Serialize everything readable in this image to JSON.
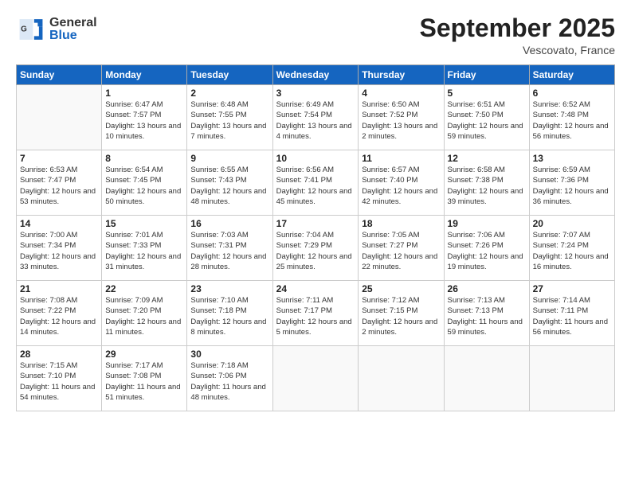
{
  "logo": {
    "general": "General",
    "blue": "Blue"
  },
  "header": {
    "month": "September 2025",
    "location": "Vescovato, France"
  },
  "weekdays": [
    "Sunday",
    "Monday",
    "Tuesday",
    "Wednesday",
    "Thursday",
    "Friday",
    "Saturday"
  ],
  "weeks": [
    [
      {
        "num": "",
        "sunrise": "",
        "sunset": "",
        "daylight": ""
      },
      {
        "num": "1",
        "sunrise": "Sunrise: 6:47 AM",
        "sunset": "Sunset: 7:57 PM",
        "daylight": "Daylight: 13 hours and 10 minutes."
      },
      {
        "num": "2",
        "sunrise": "Sunrise: 6:48 AM",
        "sunset": "Sunset: 7:55 PM",
        "daylight": "Daylight: 13 hours and 7 minutes."
      },
      {
        "num": "3",
        "sunrise": "Sunrise: 6:49 AM",
        "sunset": "Sunset: 7:54 PM",
        "daylight": "Daylight: 13 hours and 4 minutes."
      },
      {
        "num": "4",
        "sunrise": "Sunrise: 6:50 AM",
        "sunset": "Sunset: 7:52 PM",
        "daylight": "Daylight: 13 hours and 2 minutes."
      },
      {
        "num": "5",
        "sunrise": "Sunrise: 6:51 AM",
        "sunset": "Sunset: 7:50 PM",
        "daylight": "Daylight: 12 hours and 59 minutes."
      },
      {
        "num": "6",
        "sunrise": "Sunrise: 6:52 AM",
        "sunset": "Sunset: 7:48 PM",
        "daylight": "Daylight: 12 hours and 56 minutes."
      }
    ],
    [
      {
        "num": "7",
        "sunrise": "Sunrise: 6:53 AM",
        "sunset": "Sunset: 7:47 PM",
        "daylight": "Daylight: 12 hours and 53 minutes."
      },
      {
        "num": "8",
        "sunrise": "Sunrise: 6:54 AM",
        "sunset": "Sunset: 7:45 PM",
        "daylight": "Daylight: 12 hours and 50 minutes."
      },
      {
        "num": "9",
        "sunrise": "Sunrise: 6:55 AM",
        "sunset": "Sunset: 7:43 PM",
        "daylight": "Daylight: 12 hours and 48 minutes."
      },
      {
        "num": "10",
        "sunrise": "Sunrise: 6:56 AM",
        "sunset": "Sunset: 7:41 PM",
        "daylight": "Daylight: 12 hours and 45 minutes."
      },
      {
        "num": "11",
        "sunrise": "Sunrise: 6:57 AM",
        "sunset": "Sunset: 7:40 PM",
        "daylight": "Daylight: 12 hours and 42 minutes."
      },
      {
        "num": "12",
        "sunrise": "Sunrise: 6:58 AM",
        "sunset": "Sunset: 7:38 PM",
        "daylight": "Daylight: 12 hours and 39 minutes."
      },
      {
        "num": "13",
        "sunrise": "Sunrise: 6:59 AM",
        "sunset": "Sunset: 7:36 PM",
        "daylight": "Daylight: 12 hours and 36 minutes."
      }
    ],
    [
      {
        "num": "14",
        "sunrise": "Sunrise: 7:00 AM",
        "sunset": "Sunset: 7:34 PM",
        "daylight": "Daylight: 12 hours and 33 minutes."
      },
      {
        "num": "15",
        "sunrise": "Sunrise: 7:01 AM",
        "sunset": "Sunset: 7:33 PM",
        "daylight": "Daylight: 12 hours and 31 minutes."
      },
      {
        "num": "16",
        "sunrise": "Sunrise: 7:03 AM",
        "sunset": "Sunset: 7:31 PM",
        "daylight": "Daylight: 12 hours and 28 minutes."
      },
      {
        "num": "17",
        "sunrise": "Sunrise: 7:04 AM",
        "sunset": "Sunset: 7:29 PM",
        "daylight": "Daylight: 12 hours and 25 minutes."
      },
      {
        "num": "18",
        "sunrise": "Sunrise: 7:05 AM",
        "sunset": "Sunset: 7:27 PM",
        "daylight": "Daylight: 12 hours and 22 minutes."
      },
      {
        "num": "19",
        "sunrise": "Sunrise: 7:06 AM",
        "sunset": "Sunset: 7:26 PM",
        "daylight": "Daylight: 12 hours and 19 minutes."
      },
      {
        "num": "20",
        "sunrise": "Sunrise: 7:07 AM",
        "sunset": "Sunset: 7:24 PM",
        "daylight": "Daylight: 12 hours and 16 minutes."
      }
    ],
    [
      {
        "num": "21",
        "sunrise": "Sunrise: 7:08 AM",
        "sunset": "Sunset: 7:22 PM",
        "daylight": "Daylight: 12 hours and 14 minutes."
      },
      {
        "num": "22",
        "sunrise": "Sunrise: 7:09 AM",
        "sunset": "Sunset: 7:20 PM",
        "daylight": "Daylight: 12 hours and 11 minutes."
      },
      {
        "num": "23",
        "sunrise": "Sunrise: 7:10 AM",
        "sunset": "Sunset: 7:18 PM",
        "daylight": "Daylight: 12 hours and 8 minutes."
      },
      {
        "num": "24",
        "sunrise": "Sunrise: 7:11 AM",
        "sunset": "Sunset: 7:17 PM",
        "daylight": "Daylight: 12 hours and 5 minutes."
      },
      {
        "num": "25",
        "sunrise": "Sunrise: 7:12 AM",
        "sunset": "Sunset: 7:15 PM",
        "daylight": "Daylight: 12 hours and 2 minutes."
      },
      {
        "num": "26",
        "sunrise": "Sunrise: 7:13 AM",
        "sunset": "Sunset: 7:13 PM",
        "daylight": "Daylight: 11 hours and 59 minutes."
      },
      {
        "num": "27",
        "sunrise": "Sunrise: 7:14 AM",
        "sunset": "Sunset: 7:11 PM",
        "daylight": "Daylight: 11 hours and 56 minutes."
      }
    ],
    [
      {
        "num": "28",
        "sunrise": "Sunrise: 7:15 AM",
        "sunset": "Sunset: 7:10 PM",
        "daylight": "Daylight: 11 hours and 54 minutes."
      },
      {
        "num": "29",
        "sunrise": "Sunrise: 7:17 AM",
        "sunset": "Sunset: 7:08 PM",
        "daylight": "Daylight: 11 hours and 51 minutes."
      },
      {
        "num": "30",
        "sunrise": "Sunrise: 7:18 AM",
        "sunset": "Sunset: 7:06 PM",
        "daylight": "Daylight: 11 hours and 48 minutes."
      },
      {
        "num": "",
        "sunrise": "",
        "sunset": "",
        "daylight": ""
      },
      {
        "num": "",
        "sunrise": "",
        "sunset": "",
        "daylight": ""
      },
      {
        "num": "",
        "sunrise": "",
        "sunset": "",
        "daylight": ""
      },
      {
        "num": "",
        "sunrise": "",
        "sunset": "",
        "daylight": ""
      }
    ]
  ]
}
